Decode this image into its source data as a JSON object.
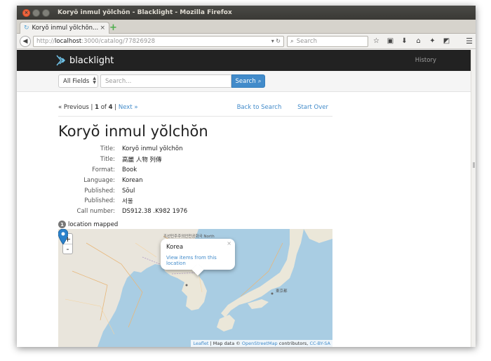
{
  "window": {
    "title": "Koryŏ inmul yŏlchŏn - Blacklight - Mozilla Firefox"
  },
  "tab": {
    "label": "Koryŏ inmul yŏlchŏn..."
  },
  "browser": {
    "url_prefix": "http://",
    "url_host": "localhost",
    "url_path": ":3000/catalog/77826928",
    "search_placeholder": "Search"
  },
  "header": {
    "brand": "blacklight",
    "history_label": "History"
  },
  "search": {
    "field": "All Fields",
    "placeholder": "Search...",
    "button_label": "Search"
  },
  "pager": {
    "previous": "« Previous",
    "separator": "|",
    "current": "1",
    "of_text": "of",
    "total": "4",
    "next": "Next »",
    "back_to_search": "Back to Search",
    "start_over": "Start Over"
  },
  "record": {
    "heading": "Koryŏ inmul yŏlchŏn",
    "fields": [
      {
        "label": "Title:",
        "value": "Koryŏ inmul yŏlchŏn"
      },
      {
        "label": "Title:",
        "value": "高麗 人物 列傳"
      },
      {
        "label": "Format:",
        "value": "Book"
      },
      {
        "label": "Language:",
        "value": "Korean"
      },
      {
        "label": "Published:",
        "value": "Sŏul"
      },
      {
        "label": "Published:",
        "value": "서울"
      },
      {
        "label": "Call number:",
        "value": "DS912.38 .K982 1976"
      }
    ]
  },
  "map": {
    "count": "1",
    "count_label": "location mapped",
    "zoom_in": "+",
    "zoom_out": "-",
    "popup_title": "Korea",
    "popup_link": "View items from this location",
    "popup_close": "×",
    "label_north": "조선민주주의인민공화국 North",
    "label_tokyo": "東京都",
    "attribution_leaflet": "Leaflet",
    "attribution_mid": "| Map data ©",
    "attribution_osm": "OpenStreetMap",
    "attribution_contrib": "contributors,",
    "attribution_license": "CC-BY-SA"
  },
  "colors": {
    "accent": "#428bca",
    "header_bg": "#222222",
    "marker": "#2a81cb"
  }
}
